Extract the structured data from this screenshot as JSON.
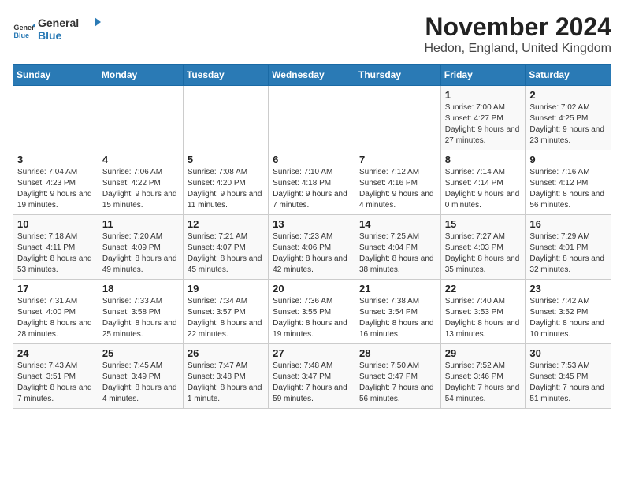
{
  "logo": {
    "general": "General",
    "blue": "Blue"
  },
  "header": {
    "month_year": "November 2024",
    "location": "Hedon, England, United Kingdom"
  },
  "days_of_week": [
    "Sunday",
    "Monday",
    "Tuesday",
    "Wednesday",
    "Thursday",
    "Friday",
    "Saturday"
  ],
  "weeks": [
    [
      {
        "day": "",
        "info": ""
      },
      {
        "day": "",
        "info": ""
      },
      {
        "day": "",
        "info": ""
      },
      {
        "day": "",
        "info": ""
      },
      {
        "day": "",
        "info": ""
      },
      {
        "day": "1",
        "info": "Sunrise: 7:00 AM\nSunset: 4:27 PM\nDaylight: 9 hours and 27 minutes."
      },
      {
        "day": "2",
        "info": "Sunrise: 7:02 AM\nSunset: 4:25 PM\nDaylight: 9 hours and 23 minutes."
      }
    ],
    [
      {
        "day": "3",
        "info": "Sunrise: 7:04 AM\nSunset: 4:23 PM\nDaylight: 9 hours and 19 minutes."
      },
      {
        "day": "4",
        "info": "Sunrise: 7:06 AM\nSunset: 4:22 PM\nDaylight: 9 hours and 15 minutes."
      },
      {
        "day": "5",
        "info": "Sunrise: 7:08 AM\nSunset: 4:20 PM\nDaylight: 9 hours and 11 minutes."
      },
      {
        "day": "6",
        "info": "Sunrise: 7:10 AM\nSunset: 4:18 PM\nDaylight: 9 hours and 7 minutes."
      },
      {
        "day": "7",
        "info": "Sunrise: 7:12 AM\nSunset: 4:16 PM\nDaylight: 9 hours and 4 minutes."
      },
      {
        "day": "8",
        "info": "Sunrise: 7:14 AM\nSunset: 4:14 PM\nDaylight: 9 hours and 0 minutes."
      },
      {
        "day": "9",
        "info": "Sunrise: 7:16 AM\nSunset: 4:12 PM\nDaylight: 8 hours and 56 minutes."
      }
    ],
    [
      {
        "day": "10",
        "info": "Sunrise: 7:18 AM\nSunset: 4:11 PM\nDaylight: 8 hours and 53 minutes."
      },
      {
        "day": "11",
        "info": "Sunrise: 7:20 AM\nSunset: 4:09 PM\nDaylight: 8 hours and 49 minutes."
      },
      {
        "day": "12",
        "info": "Sunrise: 7:21 AM\nSunset: 4:07 PM\nDaylight: 8 hours and 45 minutes."
      },
      {
        "day": "13",
        "info": "Sunrise: 7:23 AM\nSunset: 4:06 PM\nDaylight: 8 hours and 42 minutes."
      },
      {
        "day": "14",
        "info": "Sunrise: 7:25 AM\nSunset: 4:04 PM\nDaylight: 8 hours and 38 minutes."
      },
      {
        "day": "15",
        "info": "Sunrise: 7:27 AM\nSunset: 4:03 PM\nDaylight: 8 hours and 35 minutes."
      },
      {
        "day": "16",
        "info": "Sunrise: 7:29 AM\nSunset: 4:01 PM\nDaylight: 8 hours and 32 minutes."
      }
    ],
    [
      {
        "day": "17",
        "info": "Sunrise: 7:31 AM\nSunset: 4:00 PM\nDaylight: 8 hours and 28 minutes."
      },
      {
        "day": "18",
        "info": "Sunrise: 7:33 AM\nSunset: 3:58 PM\nDaylight: 8 hours and 25 minutes."
      },
      {
        "day": "19",
        "info": "Sunrise: 7:34 AM\nSunset: 3:57 PM\nDaylight: 8 hours and 22 minutes."
      },
      {
        "day": "20",
        "info": "Sunrise: 7:36 AM\nSunset: 3:55 PM\nDaylight: 8 hours and 19 minutes."
      },
      {
        "day": "21",
        "info": "Sunrise: 7:38 AM\nSunset: 3:54 PM\nDaylight: 8 hours and 16 minutes."
      },
      {
        "day": "22",
        "info": "Sunrise: 7:40 AM\nSunset: 3:53 PM\nDaylight: 8 hours and 13 minutes."
      },
      {
        "day": "23",
        "info": "Sunrise: 7:42 AM\nSunset: 3:52 PM\nDaylight: 8 hours and 10 minutes."
      }
    ],
    [
      {
        "day": "24",
        "info": "Sunrise: 7:43 AM\nSunset: 3:51 PM\nDaylight: 8 hours and 7 minutes."
      },
      {
        "day": "25",
        "info": "Sunrise: 7:45 AM\nSunset: 3:49 PM\nDaylight: 8 hours and 4 minutes."
      },
      {
        "day": "26",
        "info": "Sunrise: 7:47 AM\nSunset: 3:48 PM\nDaylight: 8 hours and 1 minute."
      },
      {
        "day": "27",
        "info": "Sunrise: 7:48 AM\nSunset: 3:47 PM\nDaylight: 7 hours and 59 minutes."
      },
      {
        "day": "28",
        "info": "Sunrise: 7:50 AM\nSunset: 3:47 PM\nDaylight: 7 hours and 56 minutes."
      },
      {
        "day": "29",
        "info": "Sunrise: 7:52 AM\nSunset: 3:46 PM\nDaylight: 7 hours and 54 minutes."
      },
      {
        "day": "30",
        "info": "Sunrise: 7:53 AM\nSunset: 3:45 PM\nDaylight: 7 hours and 51 minutes."
      }
    ]
  ]
}
